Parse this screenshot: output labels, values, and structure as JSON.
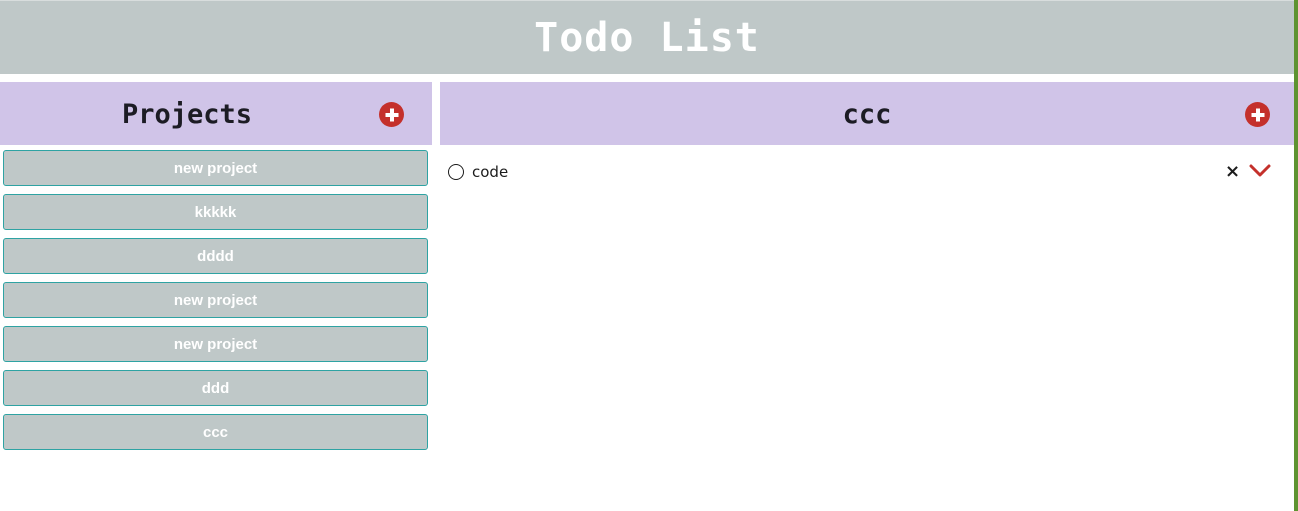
{
  "header": {
    "title": "Todo List"
  },
  "sidebar": {
    "title": "Projects",
    "add_icon": "plus-circle-icon",
    "projects": [
      {
        "label": "new project"
      },
      {
        "label": "kkkkk"
      },
      {
        "label": "dddd"
      },
      {
        "label": "new project"
      },
      {
        "label": "new project"
      },
      {
        "label": "ddd"
      },
      {
        "label": "ccc"
      }
    ]
  },
  "main": {
    "title": "ccc",
    "add_icon": "plus-circle-icon",
    "todos": [
      {
        "text": "code",
        "delete_icon": "×",
        "expand_icon": "chevron-down-icon"
      }
    ]
  },
  "colors": {
    "header_bg": "#bfc8c8",
    "panel_header_bg": "#d0c4e8",
    "accent_red": "#c4302b",
    "project_border": "#2ea3a3",
    "right_edge": "#5e9331"
  }
}
